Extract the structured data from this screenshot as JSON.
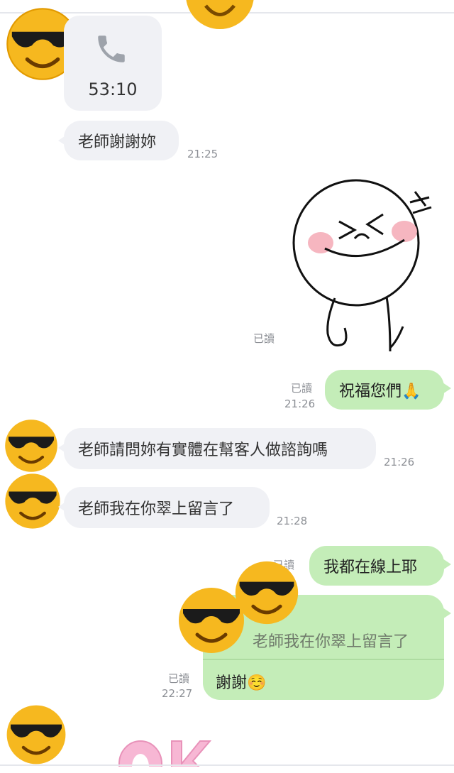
{
  "call": {
    "duration": "53:10"
  },
  "messages": [
    {
      "id": "m1",
      "dir": "in",
      "text": "老師謝謝妳",
      "time": "21:25"
    },
    {
      "id": "m2",
      "dir": "out",
      "type": "sticker",
      "read": "已讀"
    },
    {
      "id": "m3",
      "dir": "out",
      "text": "祝福您們🙏",
      "read": "已讀",
      "time": "21:26"
    },
    {
      "id": "m4",
      "dir": "in",
      "text": "老師請問妳有實體在幫客人做諮詢嗎",
      "time": "21:26"
    },
    {
      "id": "m5",
      "dir": "in",
      "text": "老師我在你翠上留言了",
      "time": "21:28"
    },
    {
      "id": "m6",
      "dir": "out",
      "text": "我都在線上耶",
      "read": "已讀"
    },
    {
      "id": "m7",
      "dir": "out",
      "quote": "老師我在你翠上留言了",
      "text": "謝謝☺️",
      "read": "已讀",
      "time": "22:27"
    }
  ],
  "colors": {
    "incoming": "#f0f1f5",
    "outgoing": "#c4edb8",
    "meta": "#8c8f95"
  },
  "icons": [
    "phone-icon",
    "sunglasses-emoji",
    "sticker-laughing",
    "sticker-ok"
  ]
}
